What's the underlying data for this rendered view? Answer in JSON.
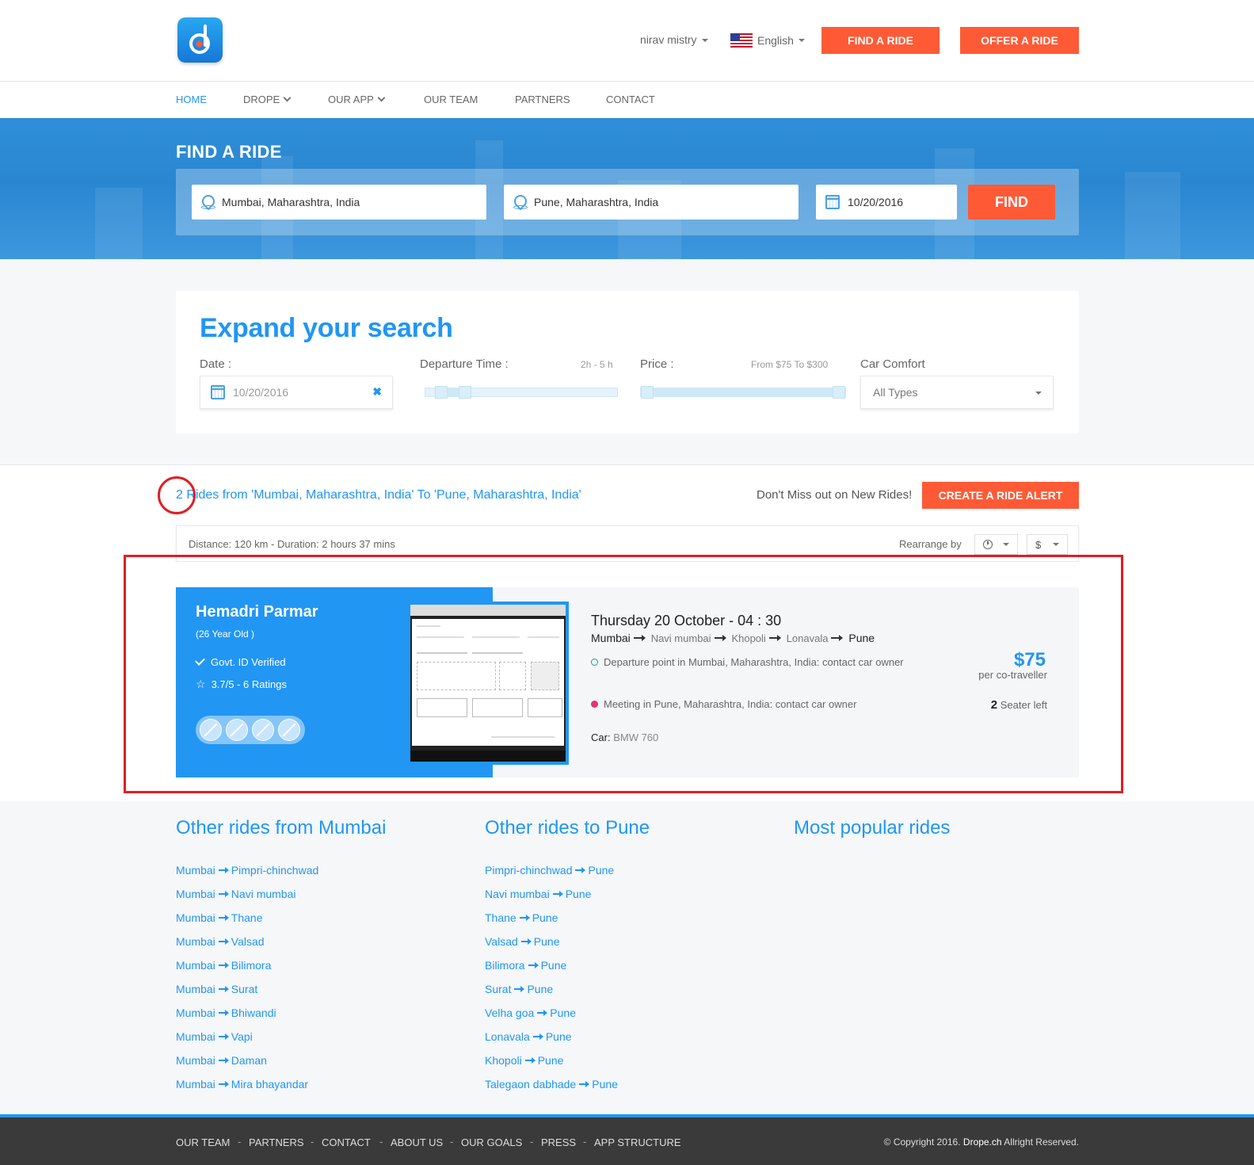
{
  "header": {
    "user_name": "nirav mistry",
    "language": "English",
    "find_ride_label": "FIND A RIDE",
    "offer_ride_label": "OFFER A RIDE"
  },
  "nav": {
    "items": [
      {
        "label": "HOME",
        "active": true
      },
      {
        "label": "DROPE",
        "has_dropdown": true
      },
      {
        "label": "OUR APP",
        "has_dropdown": true
      },
      {
        "label": "OUR TEAM"
      },
      {
        "label": "PARTNERS"
      },
      {
        "label": "CONTACT"
      }
    ]
  },
  "hero": {
    "title": "FIND A RIDE",
    "from_value": "Mumbai, Maharashtra, India",
    "to_value": "Pune, Maharashtra, India",
    "date_value": "10/20/2016",
    "find_label": "FIND"
  },
  "expand": {
    "title": "Expand your search",
    "date_label": "Date :",
    "date_value": "10/20/2016",
    "departure_label": "Departure Time :",
    "departure_hint": "2h - 5 h",
    "price_label": "Price :",
    "price_hint": "From $75 To $300",
    "comfort_label": "Car Comfort",
    "comfort_value": "All Types"
  },
  "results": {
    "title": "2 Rides from 'Mumbai, Maharashtra, India' To 'Pune, Maharashtra, India'",
    "alert_text": "Don't Miss out on New Rides!",
    "alert_button": "CREATE A RIDE ALERT",
    "distance_text": "Distance: 120 km - Duration: 2 hours 37 mins",
    "rearrange_label": "Rearrange by",
    "sort_price_symbol": "$"
  },
  "ride": {
    "driver_name": "Hemadri Parmar",
    "driver_age": "(26 Year Old )",
    "verified": "Govt. ID Verified",
    "rating": "3.7/5 - 6 Ratings",
    "date_time": "Thursday 20 October - 04 : 30",
    "origin": "Mumbai",
    "stops": [
      "Navi mumbai",
      "Khopoli",
      "Lonavala"
    ],
    "destination": "Pune",
    "departure_point": "Departure point in Mumbai, Maharashtra, India: contact car owner",
    "meeting_point": "Meeting in Pune, Maharashtra, India: contact car owner",
    "car_label": "Car:",
    "car_value": "BMW 760",
    "price": "$75",
    "price_sub": "per co-traveller",
    "seats_count": "2",
    "seats_label": "Seater left"
  },
  "other": {
    "from_title": "Other rides from Mumbai",
    "to_title": "Other rides to Pune",
    "popular_title": "Most popular rides",
    "from_routes": [
      [
        "Mumbai",
        "Pimpri-chinchwad"
      ],
      [
        "Mumbai",
        "Navi mumbai"
      ],
      [
        "Mumbai",
        "Thane"
      ],
      [
        "Mumbai",
        "Valsad"
      ],
      [
        "Mumbai",
        "Bilimora"
      ],
      [
        "Mumbai",
        "Surat"
      ],
      [
        "Mumbai",
        "Bhiwandi"
      ],
      [
        "Mumbai",
        "Vapi"
      ],
      [
        "Mumbai",
        "Daman"
      ],
      [
        "Mumbai",
        "Mira bhayandar"
      ]
    ],
    "to_routes": [
      [
        "Pimpri-chinchwad",
        "Pune"
      ],
      [
        "Navi mumbai",
        "Pune"
      ],
      [
        "Thane",
        "Pune"
      ],
      [
        "Valsad",
        "Pune"
      ],
      [
        "Bilimora",
        "Pune"
      ],
      [
        "Surat",
        "Pune"
      ],
      [
        "Velha goa",
        "Pune"
      ],
      [
        "Lonavala",
        "Pune"
      ],
      [
        "Khopoli",
        "Pune"
      ],
      [
        "Talegaon dabhade",
        "Pune"
      ]
    ]
  },
  "footer": {
    "links": [
      "OUR TEAM",
      "PARTNERS",
      "CONTACT",
      "ABOUT US",
      "OUR GOALS",
      "PRESS",
      "APP STRUCTURE"
    ],
    "copyright_prefix": "© Copyright 2016.",
    "copyright_brand": "Drope.ch",
    "copyright_suffix": "Allright Reserved."
  },
  "colors": {
    "accent": "#2196f3",
    "cta": "#ff5a36",
    "highlight": "#e31c23"
  }
}
